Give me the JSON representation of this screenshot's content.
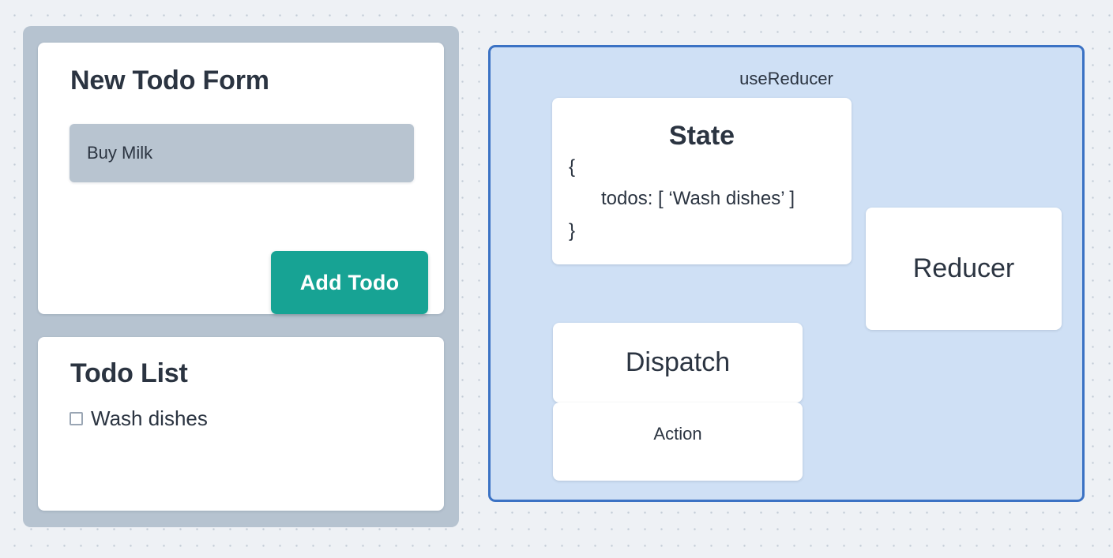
{
  "colors": {
    "canvas_background": "#eef1f5",
    "dot_grid": "#c3cbd6",
    "app_panel": "#b6c3d0",
    "card_white": "#ffffff",
    "text_dark": "#2b3441",
    "input_fill": "#b8c4d0",
    "accent_teal": "#17a394",
    "panel_blue_fill": "#cfe0f5",
    "panel_blue_border": "#3b72c4",
    "checkbox_border": "#9aa6b4"
  },
  "app_panel": {
    "new_todo_form": {
      "title": "New Todo Form",
      "input": {
        "value": "Buy Milk",
        "placeholder": "Buy Milk"
      },
      "add_button_label": "Add Todo"
    },
    "todo_list": {
      "title": "Todo List",
      "items": [
        {
          "label": "Wash dishes",
          "checked": false
        }
      ]
    }
  },
  "usereducer_panel": {
    "label": "useReducer",
    "state_card": {
      "title": "State",
      "brace_open": "{",
      "body_line": "todos: [ ‘Wash dishes’ ]",
      "brace_close": "}"
    },
    "reducer_card": {
      "title": "Reducer"
    },
    "dispatch_card": {
      "title": "Dispatch"
    },
    "action_card": {
      "title": "Action"
    }
  }
}
